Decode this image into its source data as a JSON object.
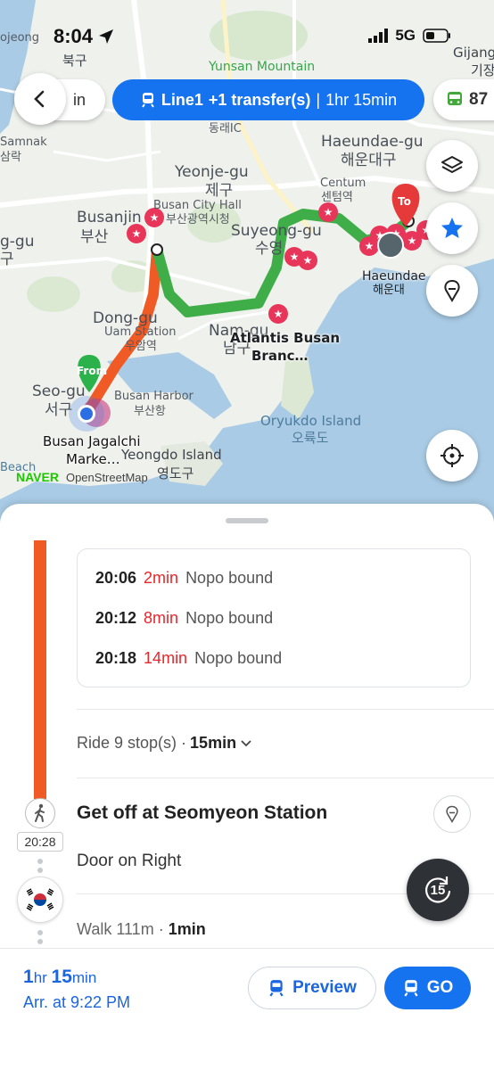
{
  "status_bar": {
    "time": "8:04",
    "carrier": "5G"
  },
  "header": {
    "left_pill_text": "in",
    "route_pill": {
      "line": "Line1",
      "transfer": "+1 transfer(s)",
      "separator": "|",
      "duration": "1hr 15min"
    },
    "right_pill_text": "87"
  },
  "map": {
    "labels": {
      "yunsan": "Yunsan Mountain",
      "bukgu_ko": "북구",
      "ojeong": "ojeong",
      "gijang": "Gijang",
      "gijang_ko": "기장",
      "samnak": "Samnak",
      "samnak_ko": "삼락",
      "ic": "동래IC",
      "haeundae_gu": "Haeundae-gu",
      "haeundae_gu_ko": "해운대구",
      "yeonje": "Yeonje-gu",
      "yeonje_ko": "제구",
      "city_hall": "Busan City Hall",
      "city_hall_ko": "부산광역시청",
      "centum": "Centum",
      "centum_ko": "센텀역",
      "busanjin": "Busanjin",
      "busanjin_ko": "부산",
      "suyeong": "Suyeong-gu",
      "suyeong_ko": "수영",
      "haeundae": "Haeundae",
      "haeundae_ko": "해운대",
      "eg_gu": "g-gu",
      "eg_gu_ko": "구",
      "dong_gu": "Dong-gu",
      "uam": "Uam Station",
      "uam_ko": "우암역",
      "nam_gu": "Nam-gu",
      "nam_gu_ko": "남구",
      "atlantis": "Atlantis Busan",
      "atlantis2": "Branc…",
      "seo_gu": "Seo-gu",
      "seo_gu_ko": "서구",
      "harbor": "Busan Harbor",
      "harbor_ko": "부산항",
      "oryukdo": "Oryukdo Island",
      "oryukdo_ko": "오륙도",
      "jagalchi": "Busan Jagalchi",
      "jagalchi2": "Marke…",
      "yeongdo": "Yeongdo Island",
      "yeongdo_ko": "영도구",
      "beach": "Beach",
      "from": "From",
      "to": "To"
    },
    "naver": "NAVER",
    "osm": "OpenStreetMap"
  },
  "sheet": {
    "departures": [
      {
        "time": "20:06",
        "wait": "2min",
        "dir": "Nopo bound"
      },
      {
        "time": "20:12",
        "wait": "8min",
        "dir": "Nopo bound"
      },
      {
        "time": "20:18",
        "wait": "14min",
        "dir": "Nopo bound"
      }
    ],
    "ride_prefix": "Ride 9 stop(s) ·",
    "ride_time": "15min",
    "get_off": "Get off at Seomyeon Station",
    "arrive_time": "20:28",
    "door": "Door on Right",
    "walk_prefix": "Walk 111m ·",
    "walk_time": "1min",
    "replay_label": "15"
  },
  "footer": {
    "dur_h": "1",
    "dur_h_unit": "hr ",
    "dur_m": "15",
    "dur_m_unit": "min",
    "arrival": "Arr. at 9:22 PM",
    "preview": "Preview",
    "go": "GO"
  },
  "colors": {
    "accent": "#1673f0",
    "subway_orange": "#f05a24",
    "subway_green": "#3fae49",
    "wait_red": "#e8272a",
    "poi_pink": "#e8365a"
  }
}
